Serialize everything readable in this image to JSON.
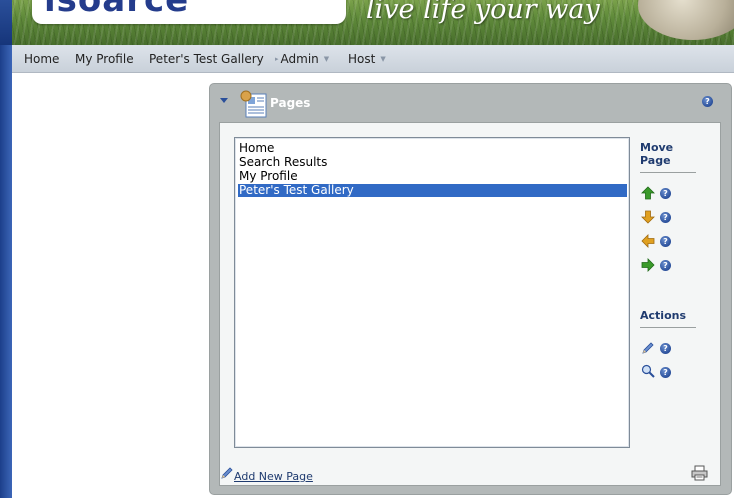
{
  "header": {
    "logo_text": "isoarcé",
    "tagline": "live life your way"
  },
  "nav": {
    "items": [
      {
        "label": "Home"
      },
      {
        "label": "My Profile"
      },
      {
        "label": "Peter's Test Gallery"
      },
      {
        "label": "Admin"
      },
      {
        "label": "Host"
      }
    ]
  },
  "module": {
    "title": "Pages",
    "help_glyph": "?",
    "pages": [
      {
        "label": "Home",
        "selected": false
      },
      {
        "label": "Search Results",
        "selected": false
      },
      {
        "label": "My Profile",
        "selected": false
      },
      {
        "label": "Peter's Test Gallery",
        "selected": true
      }
    ],
    "move_heading_line1": "Move",
    "move_heading_line2": "Page",
    "actions_heading": "Actions",
    "move_buttons": [
      {
        "icon": "arrow-up-icon",
        "color": "#3a9a2a"
      },
      {
        "icon": "arrow-down-icon",
        "color": "#e0a020"
      },
      {
        "icon": "arrow-left-icon",
        "color": "#e0a020"
      },
      {
        "icon": "arrow-right-icon",
        "color": "#3a9a2a"
      }
    ],
    "action_buttons": [
      {
        "icon": "pencil-icon"
      },
      {
        "icon": "magnifier-icon"
      }
    ],
    "add_page_label": "Add New Page",
    "print_icon": "printer-icon"
  },
  "colors": {
    "selection": "#316ac5",
    "heading": "#1f3b6f",
    "panel": "#b3b8b8"
  }
}
